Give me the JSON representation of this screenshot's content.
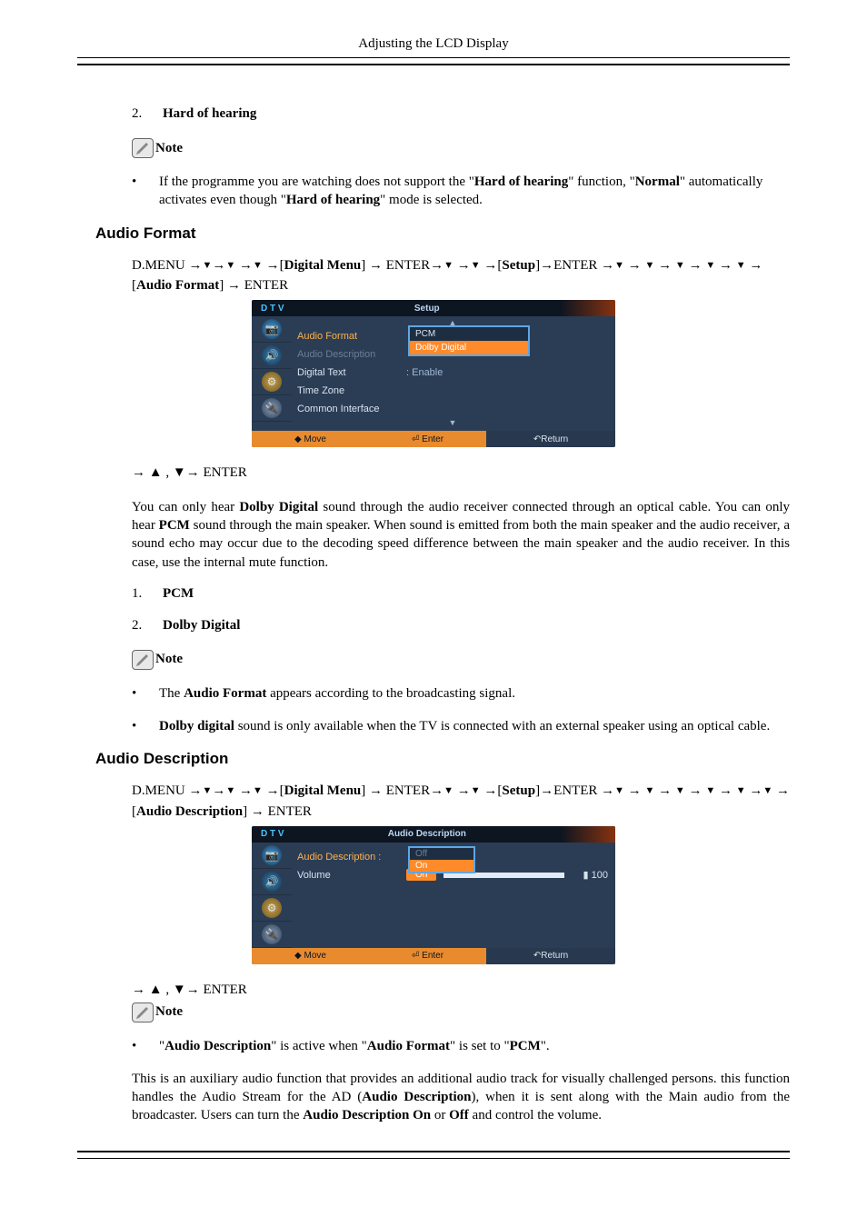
{
  "header": {
    "running": "Adjusting the LCD Display"
  },
  "s1": {
    "item2_num": "2.",
    "item2_label": "Hard of hearing",
    "note_label": "Note",
    "bullet_pre": "If the programme you are watching does not support the \"",
    "bullet_b1": "Hard of hearing",
    "bullet_mid1": "\" function, \"",
    "bullet_b2": "Normal",
    "bullet_mid2": "\" automatically activates even though \"",
    "bullet_b3": "Hard of hearing",
    "bullet_post": "\" mode is selected."
  },
  "af": {
    "heading": "Audio Format",
    "path_pre": "D.MENU ",
    "digital_menu": "Digital Menu",
    "enter": "ENTER",
    "setup": "Setup",
    "audio_format": "Audio Format",
    "osd": {
      "dtv": "D T V",
      "title": "Setup",
      "row1": "Audio Format",
      "row2": "Audio Description",
      "row3": "Digital Text",
      "row3v": ": Enable",
      "row4": "Time Zone",
      "row5": "Common Interface",
      "opt1": "PCM",
      "opt2": "Dolby Digital",
      "f1": "Move",
      "f2": "Enter",
      "f3": "Return"
    },
    "updown": "→ ▲ , ▼→ ENTER",
    "p1a": "You can only hear ",
    "p1b": "Dolby Digital",
    "p1c": " sound through the audio receiver connected through an optical cable. You can only hear ",
    "p1d": "PCM",
    "p1e": " sound through the main speaker. When sound is emitted from both the main speaker and the audio receiver, a sound echo may occur due to the decoding speed difference between the main speaker and the audio receiver. In this case, use the internal mute function.",
    "li1n": "1.",
    "li1": "PCM",
    "li2n": "2.",
    "li2": "Dolby Digital",
    "note_label": "Note",
    "nb1a": "The ",
    "nb1b": "Audio Format",
    "nb1c": " appears according to the broadcasting signal.",
    "nb2a": "Dolby digital",
    "nb2b": " sound is only available when the TV is connected with an external speaker using an optical cable."
  },
  "ad": {
    "heading": "Audio Description",
    "audio_description": "Audio Description",
    "osd": {
      "dtv": "D T V",
      "title": "Audio Description",
      "row1": "Audio Description :",
      "row2": "Volume",
      "opt_off": "Off",
      "opt_on": "On",
      "vol": "100",
      "f1": "Move",
      "f2": "Enter",
      "f3": "Return"
    },
    "updown": "→ ▲ , ▼→ ENTER",
    "note_label": "Note",
    "nb_pre": "\"",
    "nb_b1": "Audio Description",
    "nb_mid1": "\" is active when \"",
    "nb_b2": "Audio Format",
    "nb_mid2": "\" is set to \"",
    "nb_b3": "PCM",
    "nb_post": "\".",
    "p_a": "This is an auxiliary audio function that provides an additional audio track for visually challenged persons. this function handles the Audio Stream for the AD (",
    "p_b": "Audio Description",
    "p_c": "), when it is sent along with the Main audio from the broadcaster. Users can turn the ",
    "p_d": "Audio Description On",
    "p_e": " or ",
    "p_f": "Off",
    "p_g": " and control the volume."
  }
}
